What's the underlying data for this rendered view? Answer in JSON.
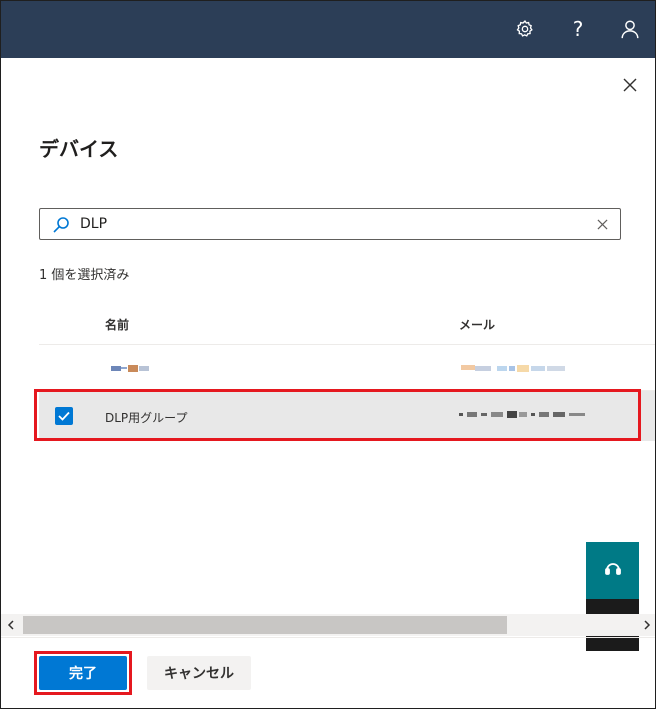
{
  "topbar": {
    "icons": [
      "gear-icon",
      "help-icon",
      "user-icon"
    ],
    "help_glyph": "?",
    "color": "#2c3e57"
  },
  "panel": {
    "title": "デバイス",
    "close_icon": "close-icon"
  },
  "search": {
    "value": "DLP",
    "icon": "search-icon",
    "clear_icon": "clear-icon"
  },
  "selection": {
    "count_text": "1 個を選択済み"
  },
  "table": {
    "columns": [
      "名前",
      "メール"
    ],
    "rows": [
      {
        "name": "",
        "mail": "",
        "selected": false,
        "redacted": true
      },
      {
        "name": "DLP用グループ",
        "mail": "",
        "selected": true,
        "redacted_mail": true
      }
    ]
  },
  "footer": {
    "done_label": "完了",
    "cancel_label": "キャンセル"
  },
  "colors": {
    "primary": "#0078d4",
    "highlight": "#e5181f",
    "side_help": "#007a86",
    "side_feedback": "#1b1b1b"
  }
}
